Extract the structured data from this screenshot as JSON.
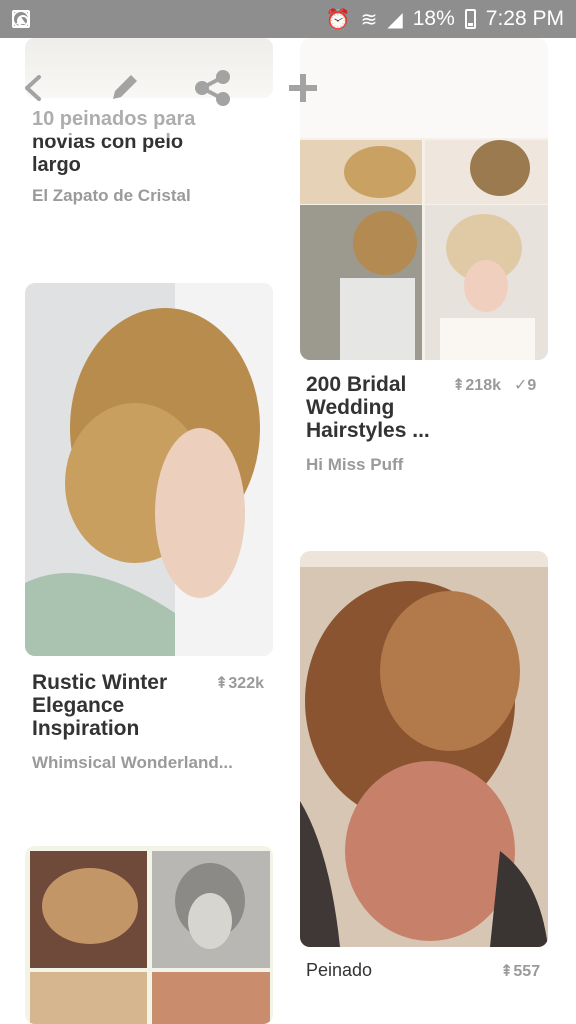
{
  "status_bar": {
    "battery": "18%",
    "time": "7:28 PM"
  },
  "toolbar": {
    "back": "back-arrow-icon",
    "edit": "pencil-icon",
    "share": "share-icon",
    "add": "plus-icon"
  },
  "pins": [
    {
      "title": "10 peinados para novias con pelo largo",
      "source": "El Zapato de Cristal"
    },
    {
      "title": "200 Bridal Wedding Hairstyles ...",
      "saves": "218k",
      "checks": "9",
      "source": "Hi Miss Puff"
    },
    {
      "title": "Rustic Winter Elegance Inspiration",
      "saves": "322k",
      "source": "Whimsical Wonderland..."
    },
    {
      "title": "Peinado",
      "saves": "557"
    }
  ],
  "colors": {
    "status_bar": "#8e8e8e",
    "text": "#333333",
    "muted": "#9a9a9a"
  }
}
